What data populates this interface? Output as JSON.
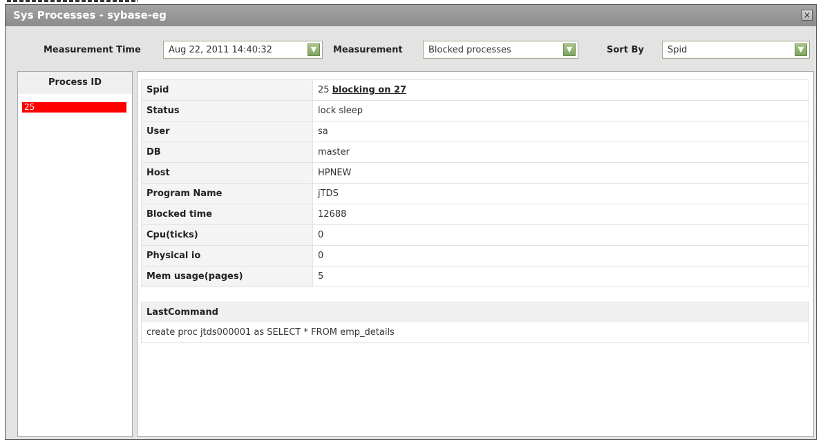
{
  "window": {
    "title": "Sys Processes - sybase-eg",
    "close_label": "×"
  },
  "toolbar": {
    "measurement_time_label": "Measurement Time",
    "measurement_time_value": "Aug 22, 2011 14:40:32",
    "measurement_label": "Measurement",
    "measurement_value": "Blocked processes",
    "sort_by_label": "Sort By",
    "sort_by_value": "Spid"
  },
  "process_list": {
    "header": "Process ID",
    "items": [
      "25"
    ]
  },
  "details": {
    "rows": [
      {
        "key": "Spid",
        "value": "25",
        "link": "blocking on 27"
      },
      {
        "key": "Status",
        "value": "lock sleep"
      },
      {
        "key": "User",
        "value": "sa"
      },
      {
        "key": "DB",
        "value": "master"
      },
      {
        "key": "Host",
        "value": "HPNEW"
      },
      {
        "key": "Program Name",
        "value": "jTDS"
      },
      {
        "key": "Blocked time",
        "value": "12688"
      },
      {
        "key": "Cpu(ticks)",
        "value": "0"
      },
      {
        "key": "Physical io",
        "value": "0"
      },
      {
        "key": "Mem usage(pages)",
        "value": "5"
      }
    ]
  },
  "last_command": {
    "header": "LastCommand",
    "text": "create proc jtds000001 as SELECT * FROM emp_details"
  },
  "colors": {
    "selected_process": "#ff0000",
    "titlebar": "#999999",
    "dropdown_arrow": "#8fb36f"
  }
}
